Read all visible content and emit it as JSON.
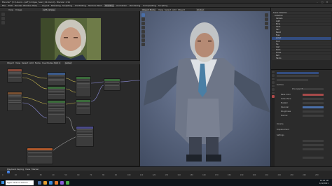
{
  "window": {
    "title": "Blender* [C:\\Users\\...\\jeff_bridges_head_02.blend] - Blender 2.91",
    "controls": [
      "–",
      "□",
      "✕"
    ]
  },
  "menubar": {
    "items": [
      "File",
      "Edit",
      "Render",
      "Window",
      "Help",
      "Layout",
      "Modeling",
      "Sculpting",
      "UV Editing",
      "Texture Paint",
      "Shading",
      "Animation",
      "Rendering",
      "Compositing",
      "Scripting"
    ],
    "active": "Shading"
  },
  "image_editor": {
    "header_items": [
      "View",
      "Image",
      "Jeff_ref.jpg"
    ],
    "tools": [
      "cursor-icon",
      "move-icon",
      "zoom-icon"
    ]
  },
  "node_editor": {
    "header_items": [
      "Object",
      "View",
      "Select",
      "Add",
      "Node",
      "Use Nodes",
      "Slot 1",
      "Jacket"
    ]
  },
  "viewport": {
    "header_items": [
      "Object Mode",
      "View",
      "Select",
      "Add",
      "Object",
      "Global"
    ],
    "tools": [
      "select-icon",
      "cursor-icon",
      "move-icon",
      "rotate-icon",
      "scale-icon",
      "transform-icon",
      "annotate-icon",
      "measure-icon"
    ],
    "gizmos": [
      "zoom-icon",
      "pan-icon",
      "camera-icon",
      "grid-icon"
    ]
  },
  "outliner": {
    "rows": [
      "Scene Collection",
      "Collection",
      "Camera",
      "Light",
      "Body",
      "Head",
      "Hair",
      "Beard",
      "Eyes",
      "Jacket",
      "Shirt",
      "Tie",
      "Vest",
      "Pants",
      "Shoes",
      "Belt",
      "Hands"
    ],
    "selected_index": 9
  },
  "properties": {
    "sections": [
      "Surface",
      "Principled BSDF",
      "Base Color",
      "Subsurface",
      "Metallic",
      "Specular",
      "Roughness",
      "Normal",
      "Volume",
      "Displacement",
      "Settings"
    ]
  },
  "timeline": {
    "header_items": [
      "Playback",
      "Keying",
      "View",
      "Marker"
    ],
    "ticks": [
      "0",
      "10",
      "20",
      "30",
      "40",
      "50",
      "60",
      "70",
      "80",
      "90",
      "100",
      "110",
      "120",
      "130",
      "140",
      "150",
      "160",
      "170",
      "180",
      "190",
      "200",
      "210",
      "220",
      "230",
      "240",
      "250"
    ],
    "current_frame": "1"
  },
  "taskbar": {
    "search_placeholder": "Type here to search",
    "time": "10:24 AM",
    "date": "1/12/2021"
  }
}
